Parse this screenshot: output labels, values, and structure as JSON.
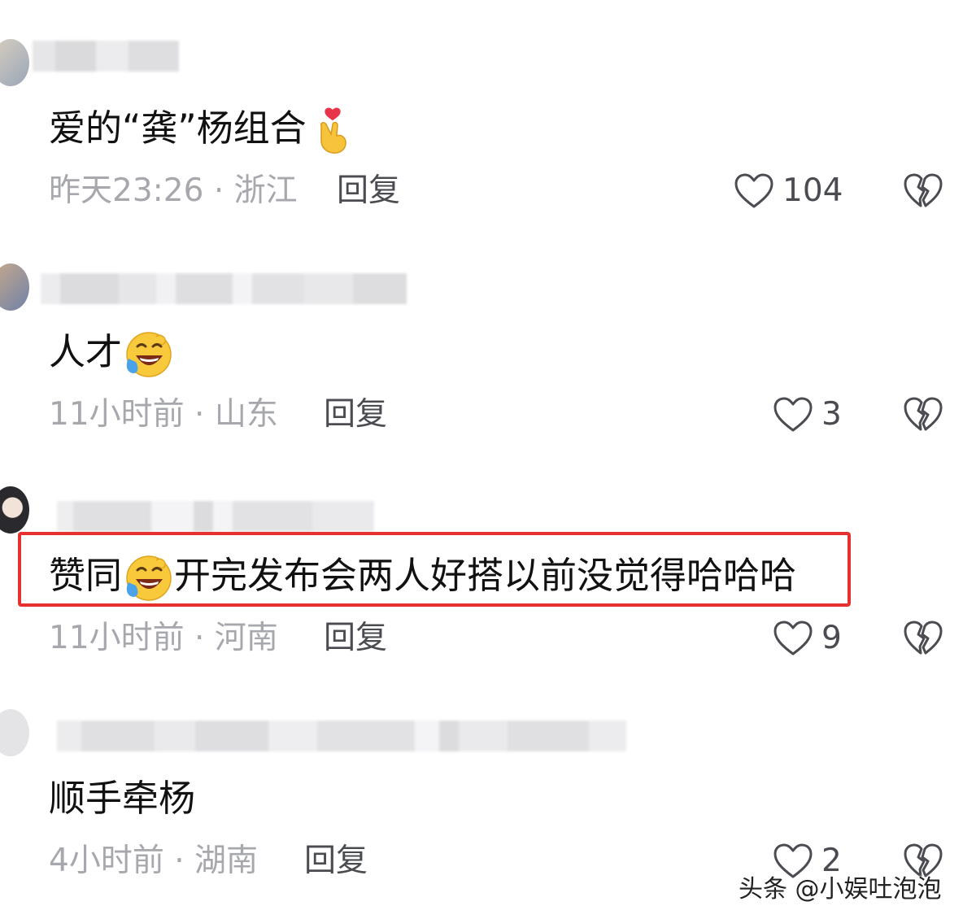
{
  "comments": [
    {
      "text_before": "爱的“龚”杨组合",
      "text_after": "",
      "emoji": "finger-heart",
      "time": "昨天23:26",
      "separator": "·",
      "location": "浙江",
      "reply_label": "回复",
      "likes": "104"
    },
    {
      "text_before": "人才",
      "text_after": "",
      "emoji": "laughing-crying",
      "time": "11小时前",
      "separator": "·",
      "location": "山东",
      "reply_label": "回复",
      "likes": "3"
    },
    {
      "text_before": "赞同",
      "text_after": "开完发布会两人好搭以前没觉得哈哈哈",
      "emoji": "laughing-crying",
      "time": "11小时前",
      "separator": "·",
      "location": "河南",
      "reply_label": "回复",
      "likes": "9",
      "highlighted": true
    },
    {
      "text_before": "顺手牵杨",
      "text_after": "",
      "emoji": "",
      "time": "4小时前",
      "separator": "·",
      "location": "湖南",
      "reply_label": "回复",
      "likes": "2"
    }
  ],
  "watermark": "头条 @小娱吐泡泡",
  "colors": {
    "highlight_border": "#e8312f",
    "meta_text": "#a6a8ad",
    "main_text": "#111111",
    "icon_stroke": "#4a4c51"
  }
}
